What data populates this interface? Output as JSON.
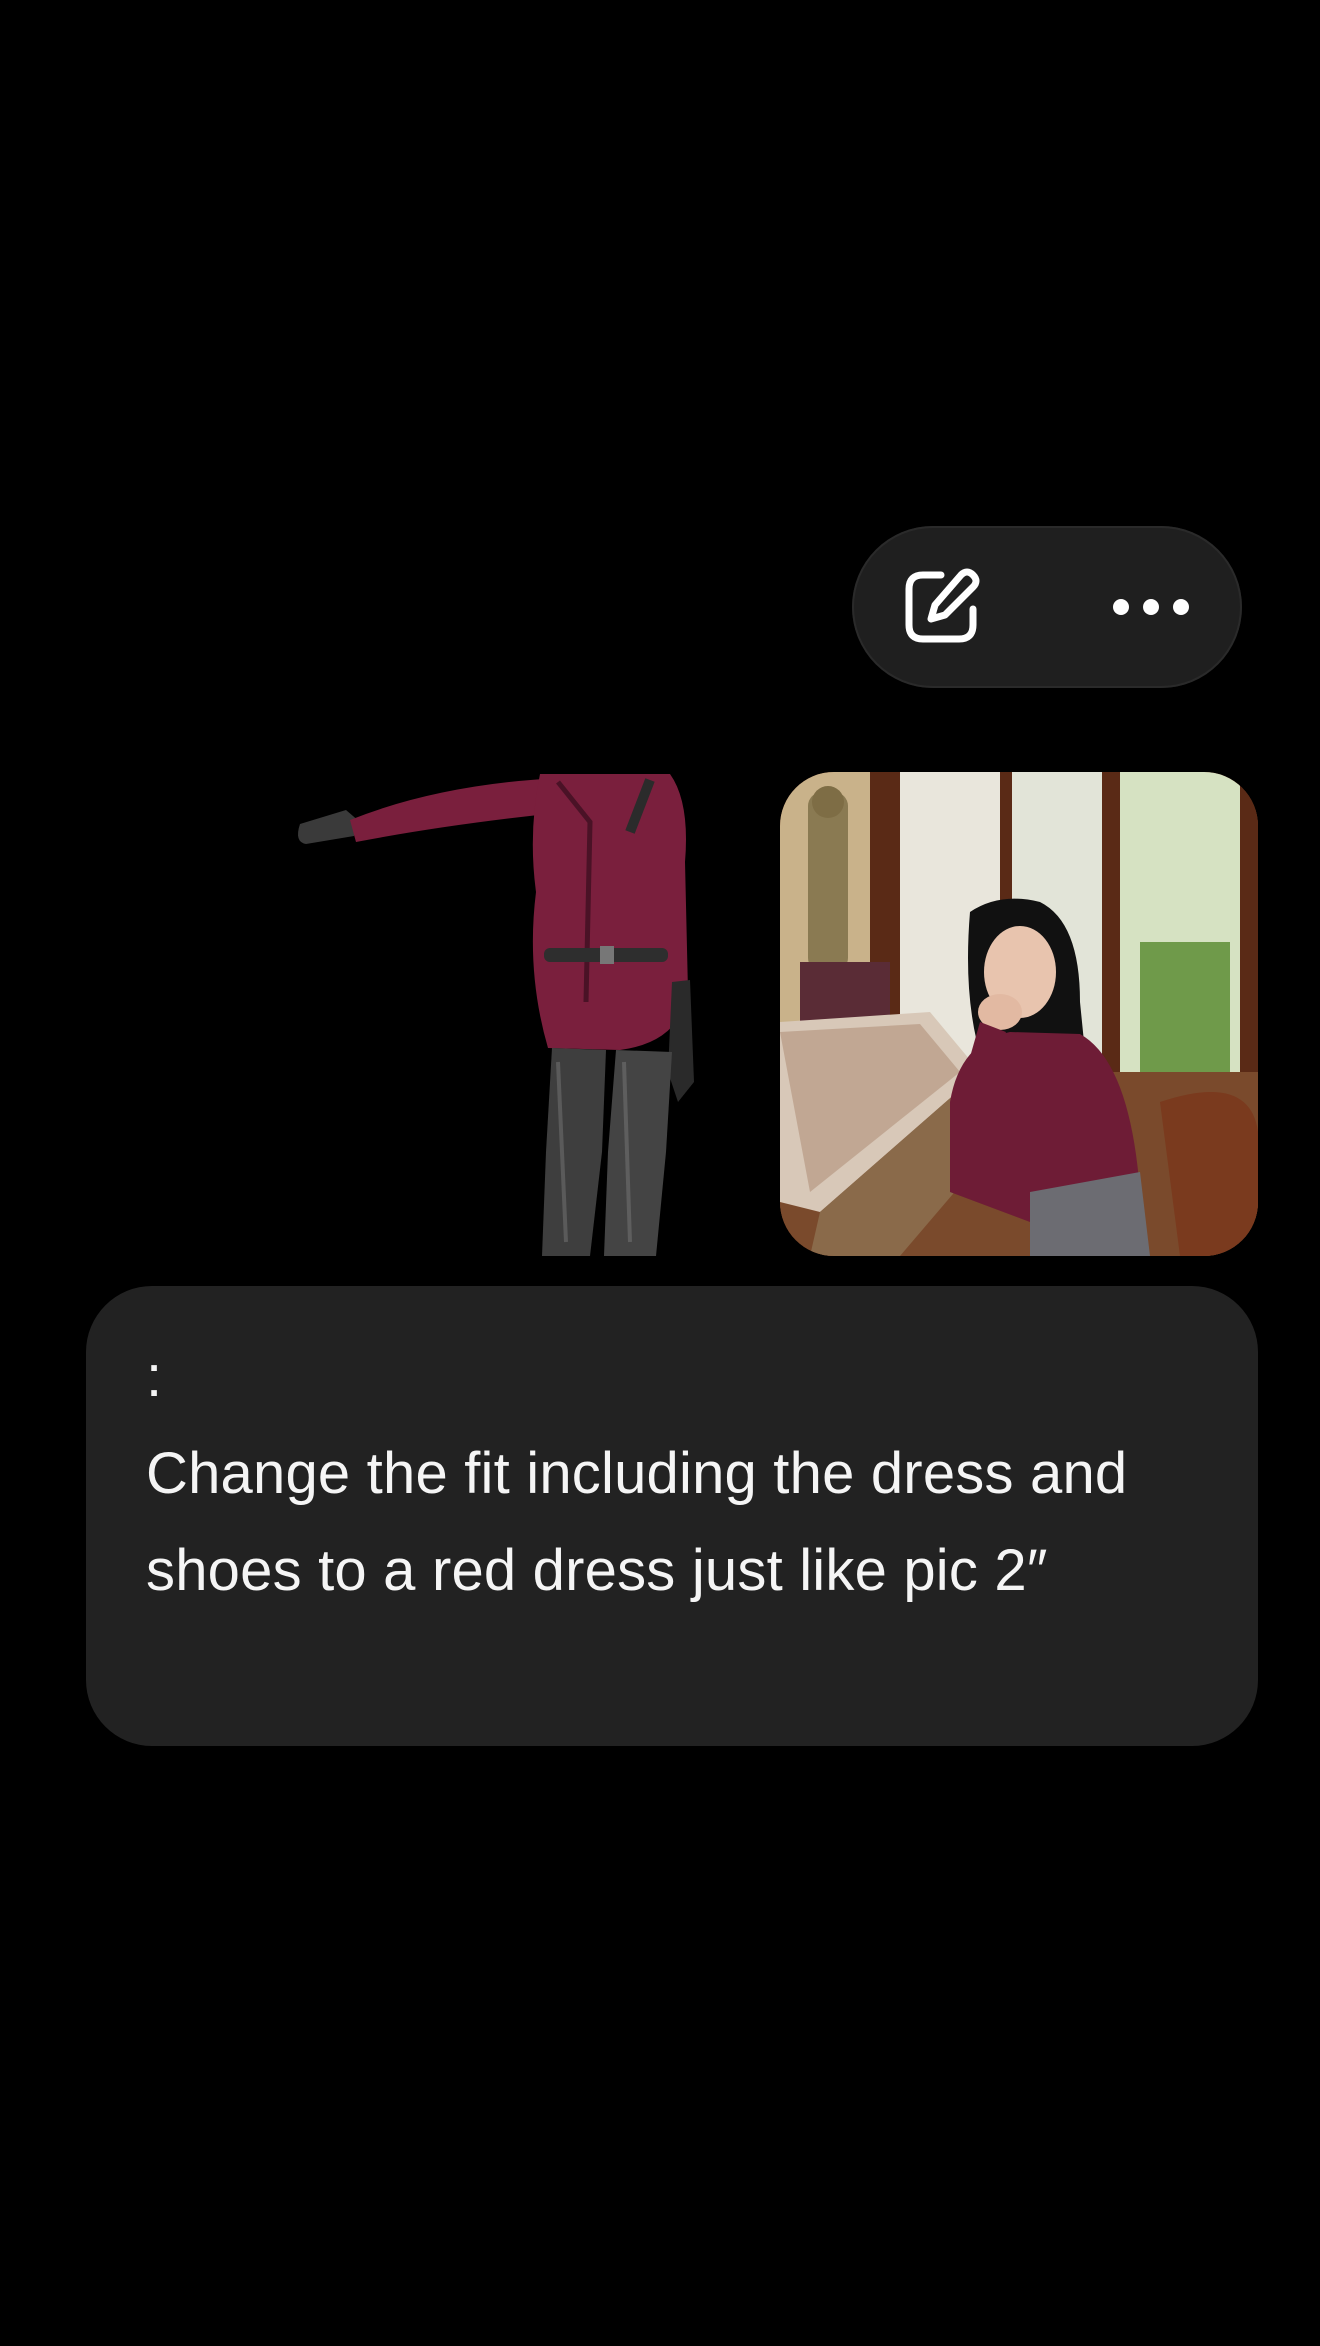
{
  "toolbar": {
    "edit_icon": "edit-icon",
    "more_icon": "more-options-icon"
  },
  "attachments": [
    {
      "kind": "image",
      "icon": "outfit-render-image"
    },
    {
      "kind": "image",
      "icon": "woman-photo-image"
    }
  ],
  "message": {
    "text": ":\nChange the fit including the dress and shoes to a red dress just like pic 2″"
  },
  "colors": {
    "background": "#000000",
    "bubble": "#222222",
    "pill": "#1f1f1f",
    "dress": "#7a1f3d"
  }
}
